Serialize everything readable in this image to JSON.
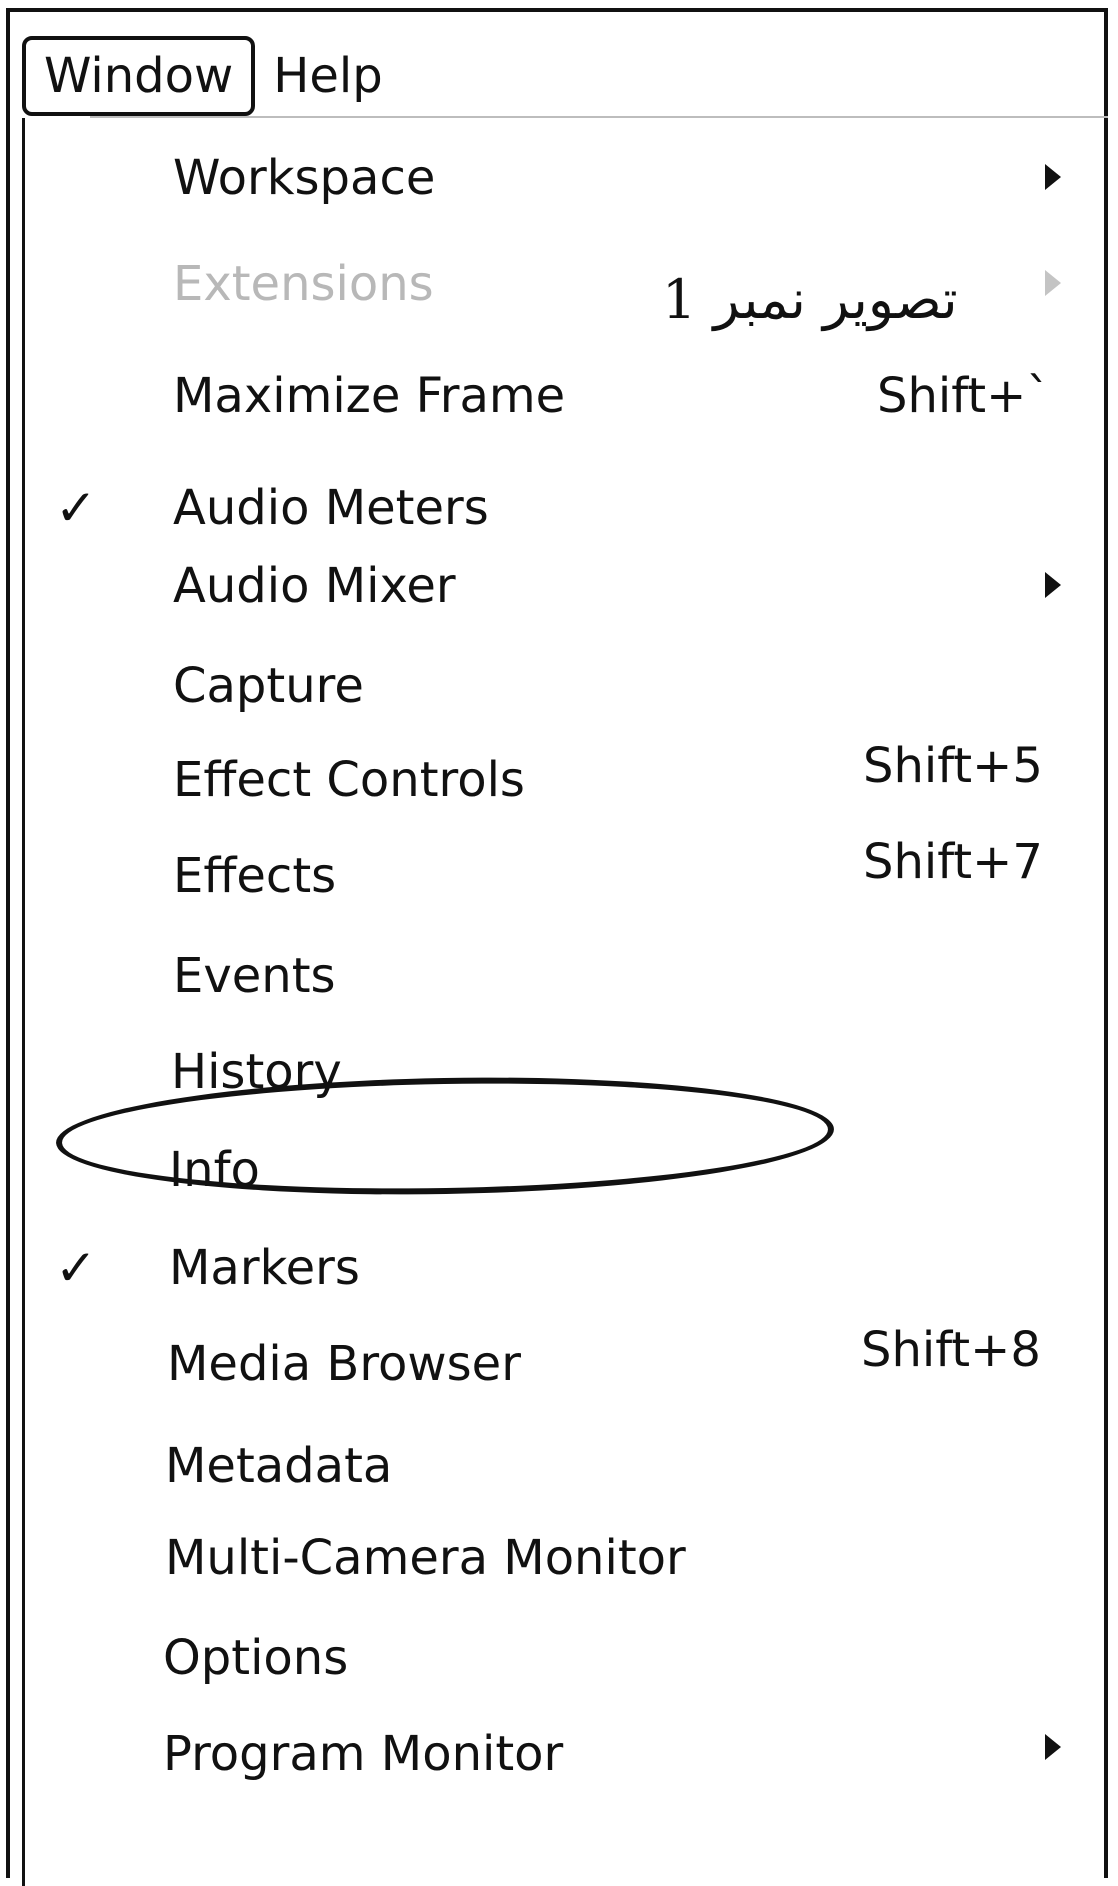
{
  "menubar": {
    "window_label": "Window",
    "help_label": "Help"
  },
  "annotation": {
    "text": "تصویر نمبر 1"
  },
  "menu": {
    "items": [
      {
        "label": "Workspace",
        "shortcut": "",
        "checked": false,
        "submenu": true,
        "disabled": false
      },
      {
        "label": "Extensions",
        "shortcut": "",
        "checked": false,
        "submenu": true,
        "disabled": true
      },
      {
        "label": "Maximize Frame",
        "shortcut": "Shift+`",
        "checked": false,
        "submenu": false,
        "disabled": false
      },
      {
        "label": "Audio Meters",
        "shortcut": "",
        "checked": true,
        "submenu": false,
        "disabled": false
      },
      {
        "label": "Audio Mixer",
        "shortcut": "",
        "checked": false,
        "submenu": true,
        "disabled": false
      },
      {
        "label": "Capture",
        "shortcut": "",
        "checked": false,
        "submenu": false,
        "disabled": false
      },
      {
        "label": "Effect Controls",
        "shortcut": "Shift+5",
        "checked": false,
        "submenu": false,
        "disabled": false
      },
      {
        "label": "Effects",
        "shortcut": "Shift+7",
        "checked": false,
        "submenu": false,
        "disabled": false
      },
      {
        "label": "Events",
        "shortcut": "",
        "checked": false,
        "submenu": false,
        "disabled": false
      },
      {
        "label": "History",
        "shortcut": "",
        "checked": false,
        "submenu": false,
        "disabled": false,
        "circled": true
      },
      {
        "label": "Info",
        "shortcut": "",
        "checked": false,
        "submenu": false,
        "disabled": false
      },
      {
        "label": "Markers",
        "shortcut": "",
        "checked": true,
        "submenu": false,
        "disabled": false
      },
      {
        "label": "Media Browser",
        "shortcut": "Shift+8",
        "checked": false,
        "submenu": false,
        "disabled": false
      },
      {
        "label": "Metadata",
        "shortcut": "",
        "checked": false,
        "submenu": false,
        "disabled": false
      },
      {
        "label": "Multi-Camera Monitor",
        "shortcut": "",
        "checked": false,
        "submenu": false,
        "disabled": false
      },
      {
        "label": "Options",
        "shortcut": "",
        "checked": false,
        "submenu": false,
        "disabled": false
      },
      {
        "label": "Program Monitor",
        "shortcut": "",
        "checked": false,
        "submenu": true,
        "disabled": false
      }
    ],
    "check_glyph": "✓"
  }
}
